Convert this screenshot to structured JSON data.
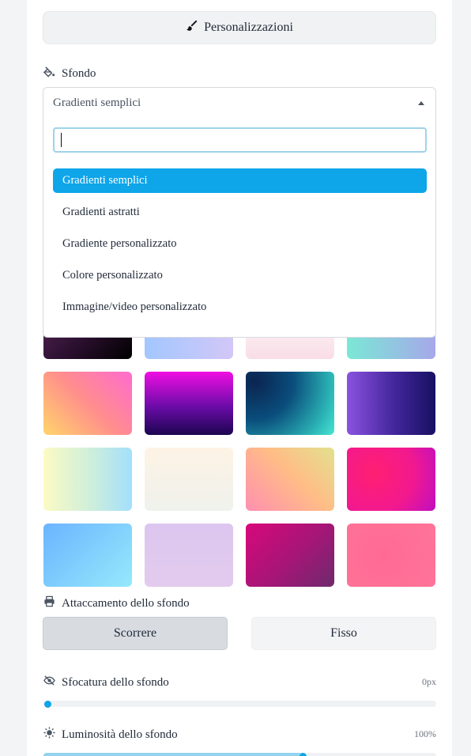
{
  "customizations_button": {
    "label": "Personalizzazioni",
    "icon": "paintbrush-icon"
  },
  "background": {
    "label": "Sfondo",
    "icon": "paint-bucket-icon",
    "select": {
      "selected": "Gradienti semplici"
    },
    "dropdown": {
      "search_value": "",
      "options": [
        {
          "label": "Gradienti semplici",
          "active": true
        },
        {
          "label": "Gradienti astratti",
          "active": false
        },
        {
          "label": "Gradiente personalizzato",
          "active": false
        },
        {
          "label": "Colore personalizzato",
          "active": false
        },
        {
          "label": "Immagine/video personalizzato",
          "active": false
        }
      ]
    }
  },
  "attachment": {
    "label": "Attaccamento dello sfondo",
    "icon": "printer-icon",
    "options": [
      {
        "label": "Scorrere",
        "selected": true
      },
      {
        "label": "Fisso",
        "selected": false
      }
    ]
  },
  "blur": {
    "label": "Sfocatura dello sfondo",
    "icon": "eye-slash-icon",
    "value_text": "0px",
    "level": 0.0
  },
  "brightness": {
    "label": "Luminosità dello sfondo",
    "icon": "sun-icon",
    "value_text": "100%",
    "level": 0.66
  },
  "colors": {
    "accent": "#0ea5e9",
    "accent_light": "#93d3ee",
    "panel": "#ffffff",
    "page": "#f3f4f6"
  }
}
